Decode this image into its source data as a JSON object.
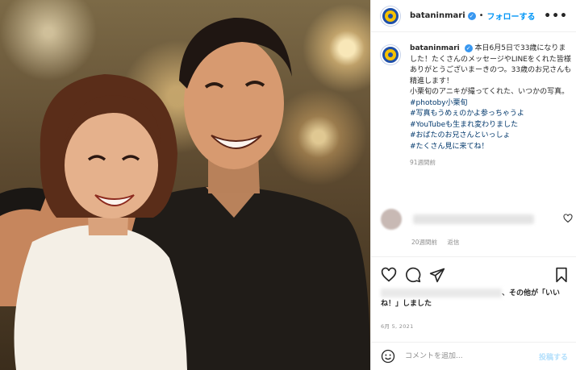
{
  "post": {
    "username": "bataninmari",
    "follow_label": "フォローする",
    "separator": "•",
    "more_label": "•••"
  },
  "caption": {
    "username": "bataninmari",
    "lines": [
      "本日6月5日で33歳になりました！たくさんのメッセージやLINEをくれた皆様ありがとうございまーきのつ。33歳のお兄さんも精進します！",
      "小栗旬のアニキが撮ってくれた、いつかの写真。"
    ],
    "hashtags": [
      "#photoby小栗旬",
      "#写真もうめぇのかよ参っちゃうよ",
      "#YouTubeも生まれ変わりました",
      "#おばたのお兄さんといっしょ",
      "#たくさん見に来てね！"
    ],
    "time_ago": "91週間前"
  },
  "comment": {
    "likes": "20週間前",
    "reply_label": "返信"
  },
  "actions": {
    "icons": [
      "heart-icon",
      "comment-icon",
      "share-icon",
      "bookmark-icon"
    ]
  },
  "likes_line": {
    "others_text": "、その他が「いいね！」しました"
  },
  "date": "6月 5, 2021",
  "add_comment": {
    "placeholder": "コメントを追加...",
    "post_label": "投稿する"
  },
  "colors": {
    "link_blue": "#0095f6",
    "hashtag": "#00376b",
    "muted": "#8e8e8e",
    "border": "#efefef"
  }
}
